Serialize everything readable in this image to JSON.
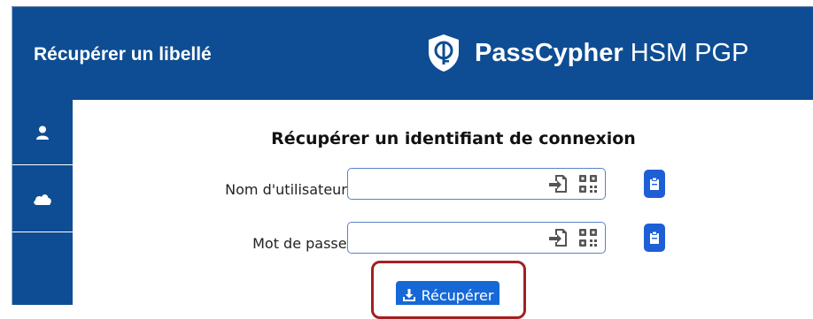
{
  "header": {
    "page_title": "Récupérer un libellé",
    "brand_name": "PassCypher",
    "brand_sub": "HSM PGP"
  },
  "sidebar": {
    "items": [
      {
        "icon": "user-icon"
      },
      {
        "icon": "cloud-icon"
      }
    ]
  },
  "form": {
    "title": "Récupérer un identifiant de connexion",
    "username_label": "Nom d'utilisateur:",
    "username_value": "",
    "password_label": "Mot de passe:",
    "password_value": "",
    "submit_label": "Récupérer"
  },
  "colors": {
    "header_bg": "#0e4d93",
    "button_bg": "#1668d6",
    "highlight": "#a32020"
  }
}
